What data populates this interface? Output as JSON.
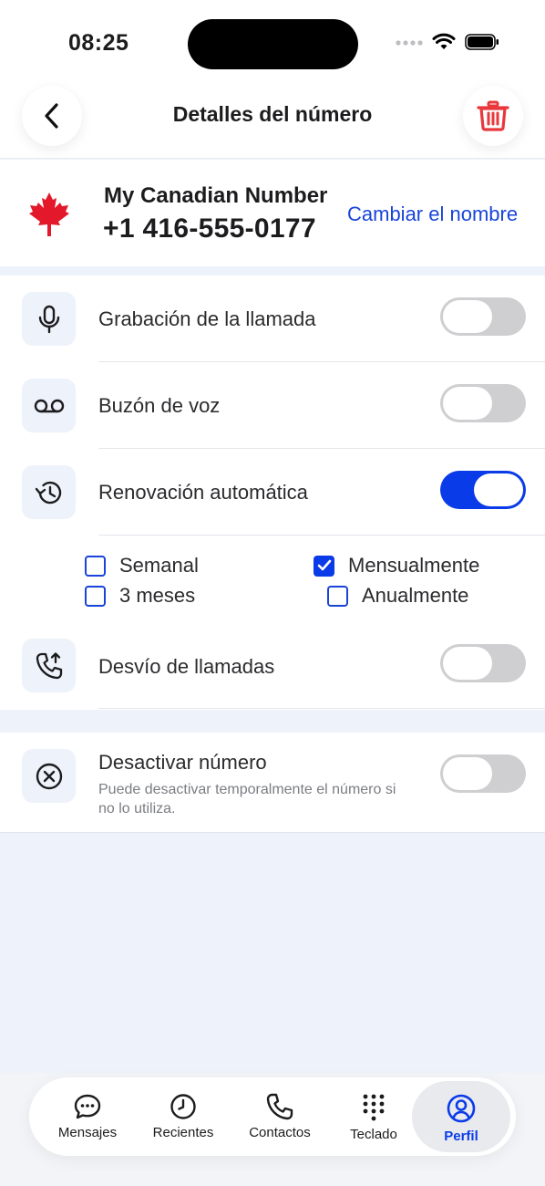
{
  "status": {
    "time": "08:25"
  },
  "header": {
    "title": "Detalles del número"
  },
  "number": {
    "name": "My Canadian Number",
    "value": "+1 416-555-0177",
    "rename_label": "Cambiar el nombre"
  },
  "settings": [
    {
      "label": "Grabación de la llamada",
      "icon": "microphone-icon",
      "enabled": false
    },
    {
      "label": "Buzón de voz",
      "icon": "voicemail-icon",
      "enabled": false
    },
    {
      "label": "Renovación automática",
      "icon": "history-icon",
      "enabled": true
    },
    {
      "label": "Desvío de llamadas",
      "icon": "call-forward-icon",
      "enabled": false
    }
  ],
  "renewal_options": [
    {
      "label": "Semanal",
      "checked": false
    },
    {
      "label": "Mensualmente",
      "checked": true
    },
    {
      "label": "3 meses",
      "checked": false
    },
    {
      "label": "Anualmente",
      "checked": false
    }
  ],
  "deactivate": {
    "label": "Desactivar número",
    "description": "Puede desactivar temporalmente el número si no lo utiliza.",
    "enabled": false
  },
  "tabs": [
    {
      "label": "Mensajes",
      "icon": "chat-bubble-icon",
      "active": false
    },
    {
      "label": "Recientes",
      "icon": "clock-icon",
      "active": false
    },
    {
      "label": "Contactos",
      "icon": "phone-icon",
      "active": false
    },
    {
      "label": "Teclado",
      "icon": "keypad-icon",
      "active": false
    },
    {
      "label": "Perfil",
      "icon": "profile-icon",
      "active": true
    }
  ],
  "colors": {
    "accent": "#0a3be8",
    "delete": "#e8383c",
    "flag_red": "#e3182a",
    "background": "#eef3fb"
  }
}
